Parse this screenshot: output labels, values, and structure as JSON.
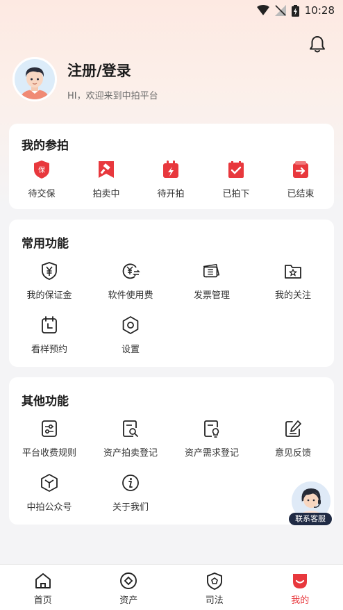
{
  "status_bar": {
    "time": "10:28"
  },
  "user": {
    "login_label": "注册/登录",
    "welcome_text": "HI，欢迎来到中拍平台"
  },
  "my_auction": {
    "title": "我的参拍",
    "items": [
      {
        "label": "待交保",
        "icon": "deposit-shield-icon"
      },
      {
        "label": "拍卖中",
        "icon": "gavel-icon"
      },
      {
        "label": "待开拍",
        "icon": "calendar-flash-icon"
      },
      {
        "label": "已拍下",
        "icon": "calendar-check-icon"
      },
      {
        "label": "已结束",
        "icon": "exit-box-icon"
      }
    ]
  },
  "common_functions": {
    "title": "常用功能",
    "items": [
      {
        "label": "我的保证金",
        "icon": "yuan-shield-icon"
      },
      {
        "label": "软件使用费",
        "icon": "yuan-exchange-icon"
      },
      {
        "label": "发票管理",
        "icon": "invoice-icon"
      },
      {
        "label": "我的关注",
        "icon": "star-folder-icon"
      },
      {
        "label": "看样预约",
        "icon": "calendar-clock-icon"
      },
      {
        "label": "设置",
        "icon": "settings-hexagon-icon"
      }
    ]
  },
  "other_functions": {
    "title": "其他功能",
    "items": [
      {
        "label": "平台收费规则",
        "icon": "sliders-icon"
      },
      {
        "label": "资产拍卖登记",
        "icon": "doc-search-icon"
      },
      {
        "label": "资产需求登记",
        "icon": "doc-bulb-icon"
      },
      {
        "label": "意见反馈",
        "icon": "edit-icon"
      },
      {
        "label": "中拍公众号",
        "icon": "cube-icon"
      },
      {
        "label": "关于我们",
        "icon": "info-icon"
      }
    ]
  },
  "customer_service": {
    "label": "联系客服"
  },
  "bottom_nav": {
    "items": [
      {
        "label": "首页",
        "icon": "home-icon"
      },
      {
        "label": "资产",
        "icon": "asset-diamond-icon"
      },
      {
        "label": "司法",
        "icon": "justice-pentagon-icon"
      },
      {
        "label": "我的",
        "icon": "profile-icon"
      }
    ],
    "active_index": 3
  },
  "colors": {
    "accent": "#e8383d",
    "dark": "#1c1c1c"
  }
}
